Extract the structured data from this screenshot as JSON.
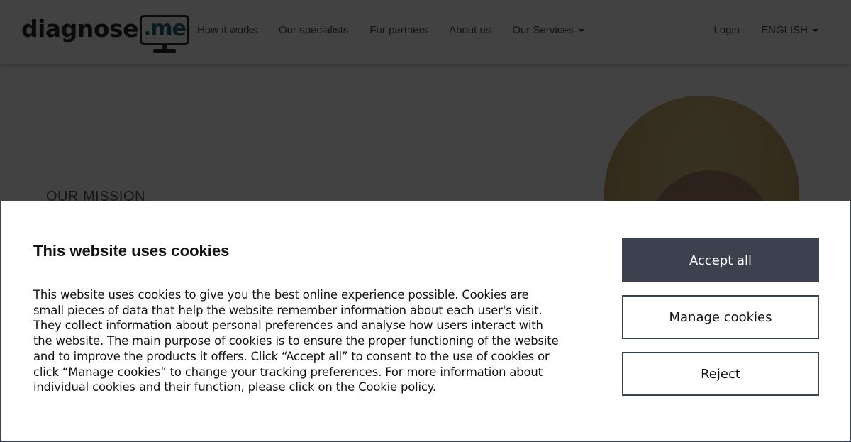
{
  "header": {
    "logo": {
      "word": "diagnose",
      "suffix": ".me"
    },
    "nav": [
      {
        "label": "How it works"
      },
      {
        "label": "Our specialists"
      },
      {
        "label": "For partners"
      },
      {
        "label": "About us"
      },
      {
        "label": "Our Services",
        "has_dropdown": true
      }
    ],
    "login_label": "Login",
    "language": {
      "selected": "ENGLISH",
      "has_dropdown": true
    }
  },
  "hero": {
    "kicker": "OUR MISSION"
  },
  "cookie_banner": {
    "title": "This website uses cookies",
    "text_lines": [
      "This website uses cookies to give you the best online experience possible. Cookies are",
      "small pieces of data that help the website remember information about each user's visit.",
      "They collect information about personal preferences and analyse how users interact with",
      "the website. The main purpose of cookies is to ensure the proper functioning of the website",
      "and to improve the products it offers. Click “Accept all” to consent to the use of cookies or",
      "click “Manage cookies” to change your tracking preferences. For more information about"
    ],
    "last_line_prefix": "individual cookies and their function, please click on the ",
    "policy_link_label": "Cookie policy",
    "last_line_suffix": ".",
    "buttons": {
      "accept": "Accept all",
      "manage": "Manage cookies",
      "reject": "Reject"
    }
  },
  "colors": {
    "primary_dark": "#3c4150",
    "logo_accent": "#1f6d78",
    "overlay": "rgba(0,0,0,0.74)"
  }
}
